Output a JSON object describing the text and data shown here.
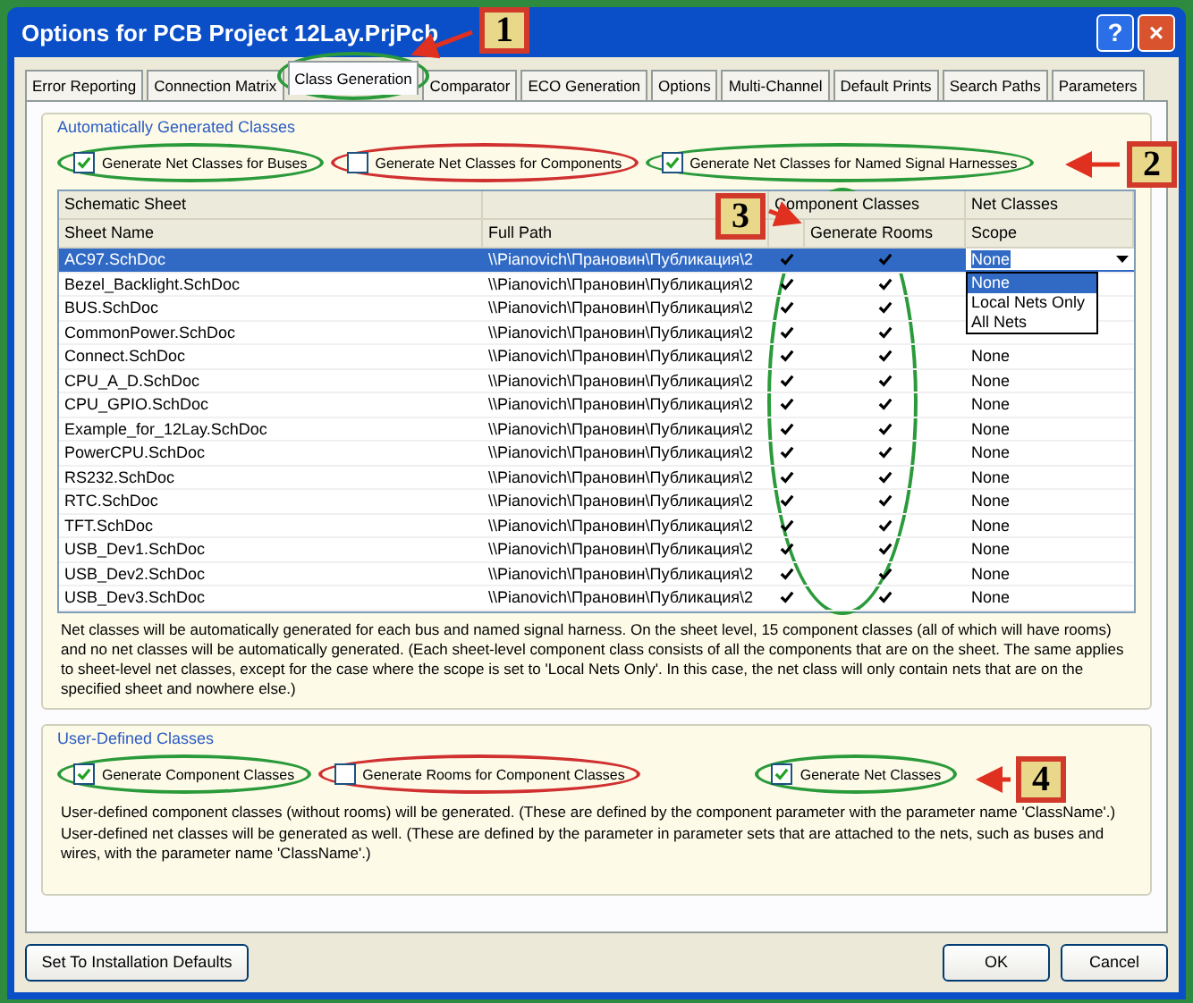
{
  "window": {
    "title": "Options for PCB Project 12Lay.PrjPcb",
    "help": "?",
    "close": "×"
  },
  "tabs": [
    {
      "label": "Error Reporting",
      "selected": false
    },
    {
      "label": "Connection Matrix",
      "selected": false
    },
    {
      "label": "Class Generation",
      "selected": true
    },
    {
      "label": "Comparator",
      "selected": false
    },
    {
      "label": "ECO Generation",
      "selected": false
    },
    {
      "label": "Options",
      "selected": false
    },
    {
      "label": "Multi-Channel",
      "selected": false
    },
    {
      "label": "Default Prints",
      "selected": false
    },
    {
      "label": "Search Paths",
      "selected": false
    },
    {
      "label": "Parameters",
      "selected": false
    }
  ],
  "auto_group": {
    "title": "Automatically Generated Classes",
    "options": [
      {
        "label": "Generate Net Classes for Buses",
        "checked": true
      },
      {
        "label": "Generate Net Classes for Components",
        "checked": false
      },
      {
        "label": "Generate Net Classes for Named Signal Harnesses",
        "checked": true
      }
    ],
    "table": {
      "group_headers": [
        "Schematic Sheet",
        "Component Classes",
        "Net Classes"
      ],
      "columns": [
        "Sheet Name",
        "Full Path",
        "Generate Rooms",
        "Scope"
      ],
      "rows": [
        {
          "sheet": "AC97.SchDoc",
          "path": "\\\\Pianovich\\Прановин\\Публикация\\2",
          "component_class": true,
          "rooms": true,
          "scope": "None",
          "selected": true
        },
        {
          "sheet": "Bezel_Backlight.SchDoc",
          "path": "\\\\Pianovich\\Прановин\\Публикация\\2",
          "component_class": true,
          "rooms": true,
          "selected": false
        },
        {
          "sheet": "BUS.SchDoc",
          "path": "\\\\Pianovich\\Прановин\\Публикация\\2",
          "component_class": true,
          "rooms": true,
          "selected": false
        },
        {
          "sheet": "CommonPower.SchDoc",
          "path": "\\\\Pianovich\\Прановин\\Публикация\\2",
          "component_class": true,
          "rooms": true,
          "selected": false
        },
        {
          "sheet": "Connect.SchDoc",
          "path": "\\\\Pianovich\\Прановин\\Публикация\\2",
          "component_class": true,
          "rooms": true,
          "scope": "None",
          "selected": false
        },
        {
          "sheet": "CPU_A_D.SchDoc",
          "path": "\\\\Pianovich\\Прановин\\Публикация\\2",
          "component_class": true,
          "rooms": true,
          "scope": "None",
          "selected": false
        },
        {
          "sheet": "CPU_GPIO.SchDoc",
          "path": "\\\\Pianovich\\Прановин\\Публикация\\2",
          "component_class": true,
          "rooms": true,
          "scope": "None",
          "selected": false
        },
        {
          "sheet": "Example_for_12Lay.SchDoc",
          "path": "\\\\Pianovich\\Прановин\\Публикация\\2",
          "component_class": true,
          "rooms": true,
          "scope": "None",
          "selected": false
        },
        {
          "sheet": "PowerCPU.SchDoc",
          "path": "\\\\Pianovich\\Прановин\\Публикация\\2",
          "component_class": true,
          "rooms": true,
          "scope": "None",
          "selected": false
        },
        {
          "sheet": "RS232.SchDoc",
          "path": "\\\\Pianovich\\Прановин\\Публикация\\2",
          "component_class": true,
          "rooms": true,
          "scope": "None",
          "selected": false
        },
        {
          "sheet": "RTC.SchDoc",
          "path": "\\\\Pianovich\\Прановин\\Публикация\\2",
          "component_class": true,
          "rooms": true,
          "scope": "None",
          "selected": false
        },
        {
          "sheet": "TFT.SchDoc",
          "path": "\\\\Pianovich\\Прановин\\Публикация\\2",
          "component_class": true,
          "rooms": true,
          "scope": "None",
          "selected": false
        },
        {
          "sheet": "USB_Dev1.SchDoc",
          "path": "\\\\Pianovich\\Прановин\\Публикация\\2",
          "component_class": true,
          "rooms": true,
          "scope": "None",
          "selected": false
        },
        {
          "sheet": "USB_Dev2.SchDoc",
          "path": "\\\\Pianovich\\Прановин\\Публикация\\2",
          "component_class": true,
          "rooms": true,
          "scope": "None",
          "selected": false
        },
        {
          "sheet": "USB_Dev3.SchDoc",
          "path": "\\\\Pianovich\\Прановин\\Публикация\\2",
          "component_class": true,
          "rooms": true,
          "scope": "None",
          "selected": false
        }
      ]
    },
    "dropdown": {
      "options": [
        {
          "label": "None",
          "selected": true
        },
        {
          "label": "Local Nets Only",
          "selected": false
        },
        {
          "label": "All Nets",
          "selected": false
        }
      ]
    },
    "description": "Net classes will be automatically generated for each bus and named signal harness. On the sheet level, 15 component classes (all of which will have rooms) and no net classes will be automatically generated. (Each sheet-level component class consists of all the components that are on the sheet. The same applies to sheet-level net classes, except for the case where the scope is set to 'Local Nets Only'. In this case, the net class will only contain nets that are on the specified sheet and nowhere else.)"
  },
  "user_group": {
    "title": "User-Defined Classes",
    "options": [
      {
        "label": "Generate Component Classes",
        "checked": true
      },
      {
        "label": "Generate Rooms for Component Classes",
        "checked": false
      },
      {
        "label": "Generate Net Classes",
        "checked": true
      }
    ],
    "description": [
      "User-defined component classes (without rooms) will be generated. (These are defined by the component parameter with the parameter name 'ClassName'.)",
      "User-defined net classes will be generated as well. (These are defined by the parameter in parameter sets that are attached to the nets, such as buses and wires, with the parameter name 'ClassName'.)"
    ]
  },
  "buttons": {
    "defaults": "Set To Installation Defaults",
    "ok": "OK",
    "cancel": "Cancel"
  },
  "callouts": [
    "1",
    "2",
    "3",
    "4"
  ]
}
